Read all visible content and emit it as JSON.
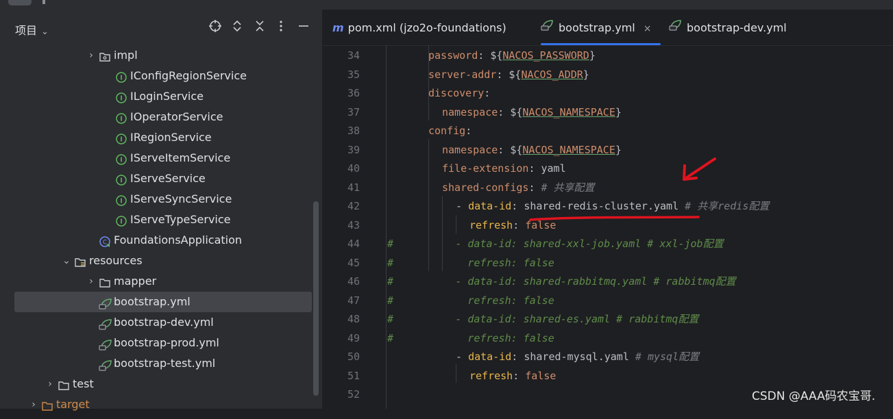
{
  "sidebar": {
    "title": "项目",
    "tree": [
      {
        "label": "impl",
        "indent": 3,
        "type": "package",
        "twisty": "›"
      },
      {
        "label": "IConfigRegionService",
        "indent": 4,
        "type": "interface"
      },
      {
        "label": "ILoginService",
        "indent": 4,
        "type": "interface"
      },
      {
        "label": "IOperatorService",
        "indent": 4,
        "type": "interface"
      },
      {
        "label": "IRegionService",
        "indent": 4,
        "type": "interface"
      },
      {
        "label": "IServeItemService",
        "indent": 4,
        "type": "interface"
      },
      {
        "label": "IServeService",
        "indent": 4,
        "type": "interface"
      },
      {
        "label": "IServeSyncService",
        "indent": 4,
        "type": "interface"
      },
      {
        "label": "IServeTypeService",
        "indent": 4,
        "type": "interface"
      },
      {
        "label": "FoundationsApplication",
        "indent": 3,
        "type": "app"
      },
      {
        "label": "resources",
        "indent": 2,
        "type": "resfolder",
        "twisty": "⌄"
      },
      {
        "label": "mapper",
        "indent": 3,
        "type": "folder",
        "twisty": "›"
      },
      {
        "label": "bootstrap.yml",
        "indent": 3,
        "type": "yml",
        "selected": true
      },
      {
        "label": "bootstrap-dev.yml",
        "indent": 3,
        "type": "yml"
      },
      {
        "label": "bootstrap-prod.yml",
        "indent": 3,
        "type": "yml"
      },
      {
        "label": "bootstrap-test.yml",
        "indent": 3,
        "type": "yml"
      },
      {
        "label": "test",
        "indent": 1,
        "type": "folder",
        "twisty": "›"
      },
      {
        "label": "target",
        "indent": 0,
        "type": "folder-orange",
        "twisty": "›"
      }
    ]
  },
  "tabs": [
    {
      "label": "pom.xml (jzo2o-foundations)",
      "icon": "maven-icon",
      "icon_glyph": "m"
    },
    {
      "label": "bootstrap.yml",
      "icon": "spring-leaf-icon",
      "active": true,
      "close": "×"
    },
    {
      "label": "bootstrap-dev.yml",
      "icon": "spring-leaf-icon"
    }
  ],
  "editor": {
    "line_numbers": [
      "34",
      "35",
      "36",
      "37",
      "38",
      "39",
      "40",
      "41",
      "42",
      "43",
      "44",
      "45",
      "46",
      "47",
      "48",
      "49",
      "50",
      "51",
      "52"
    ],
    "lines": [
      {
        "indent": 0,
        "key": "password",
        "sep": ": ",
        "pre": "${",
        "var": "NACOS_PASSWORD",
        "post": "}"
      },
      {
        "indent": 0,
        "key": "server-addr",
        "sep": ": ",
        "pre": "${",
        "var": "NACOS_ADDR",
        "post": "}"
      },
      {
        "indent": 0,
        "key": "discovery",
        "sep": ":"
      },
      {
        "indent": 1,
        "key": "namespace",
        "sep": ": ",
        "pre": "${",
        "var": "NACOS_NAMESPACE",
        "post": "}"
      },
      {
        "indent": 0,
        "key": "config",
        "sep": ":"
      },
      {
        "indent": 1,
        "key": "namespace",
        "sep": ": ",
        "pre": "${",
        "var": "NACOS_NAMESPACE",
        "post": "}"
      },
      {
        "indent": 1,
        "key": "file-extension",
        "sep": ": ",
        "val": "yaml"
      },
      {
        "indent": 1,
        "key": "shared-configs",
        "sep": ": ",
        "comment": "# 共享配置"
      },
      {
        "indent": 2,
        "dash": "- ",
        "key2": "data-id",
        "sep": ": ",
        "val": "shared-redis-cluster.yaml",
        "comment": " # 共享redis配置"
      },
      {
        "indent": 3,
        "key2": "refresh",
        "sep": ": ",
        "bool": "false"
      },
      {
        "hash": "#",
        "gcomment": "  - data-id: shared-xxl-job.yaml # xxl-job配置"
      },
      {
        "hash": "#",
        "gcomment": "    refresh: false"
      },
      {
        "hash": "#",
        "gcomment": "  - data-id: shared-rabbitmq.yaml # rabbitmq配置"
      },
      {
        "hash": "#",
        "gcomment": "    refresh: false"
      },
      {
        "hash": "#",
        "gcomment": "  - data-id: shared-es.yaml # rabbitmq配置"
      },
      {
        "hash": "#",
        "gcomment": "    refresh: false"
      },
      {
        "indent": 2,
        "dash": "- ",
        "key2": "data-id",
        "sep": ": ",
        "val": "shared-mysql.yaml",
        "comment": " # mysql配置"
      },
      {
        "indent": 3,
        "key2": "refresh",
        "sep": ": ",
        "bool": "false"
      },
      {
        "indent": 0
      }
    ]
  },
  "watermark": "CSDN @AAA码农宝哥.",
  "colors": {
    "accent": "#3574f0",
    "annotation_red": "#e0141e"
  }
}
